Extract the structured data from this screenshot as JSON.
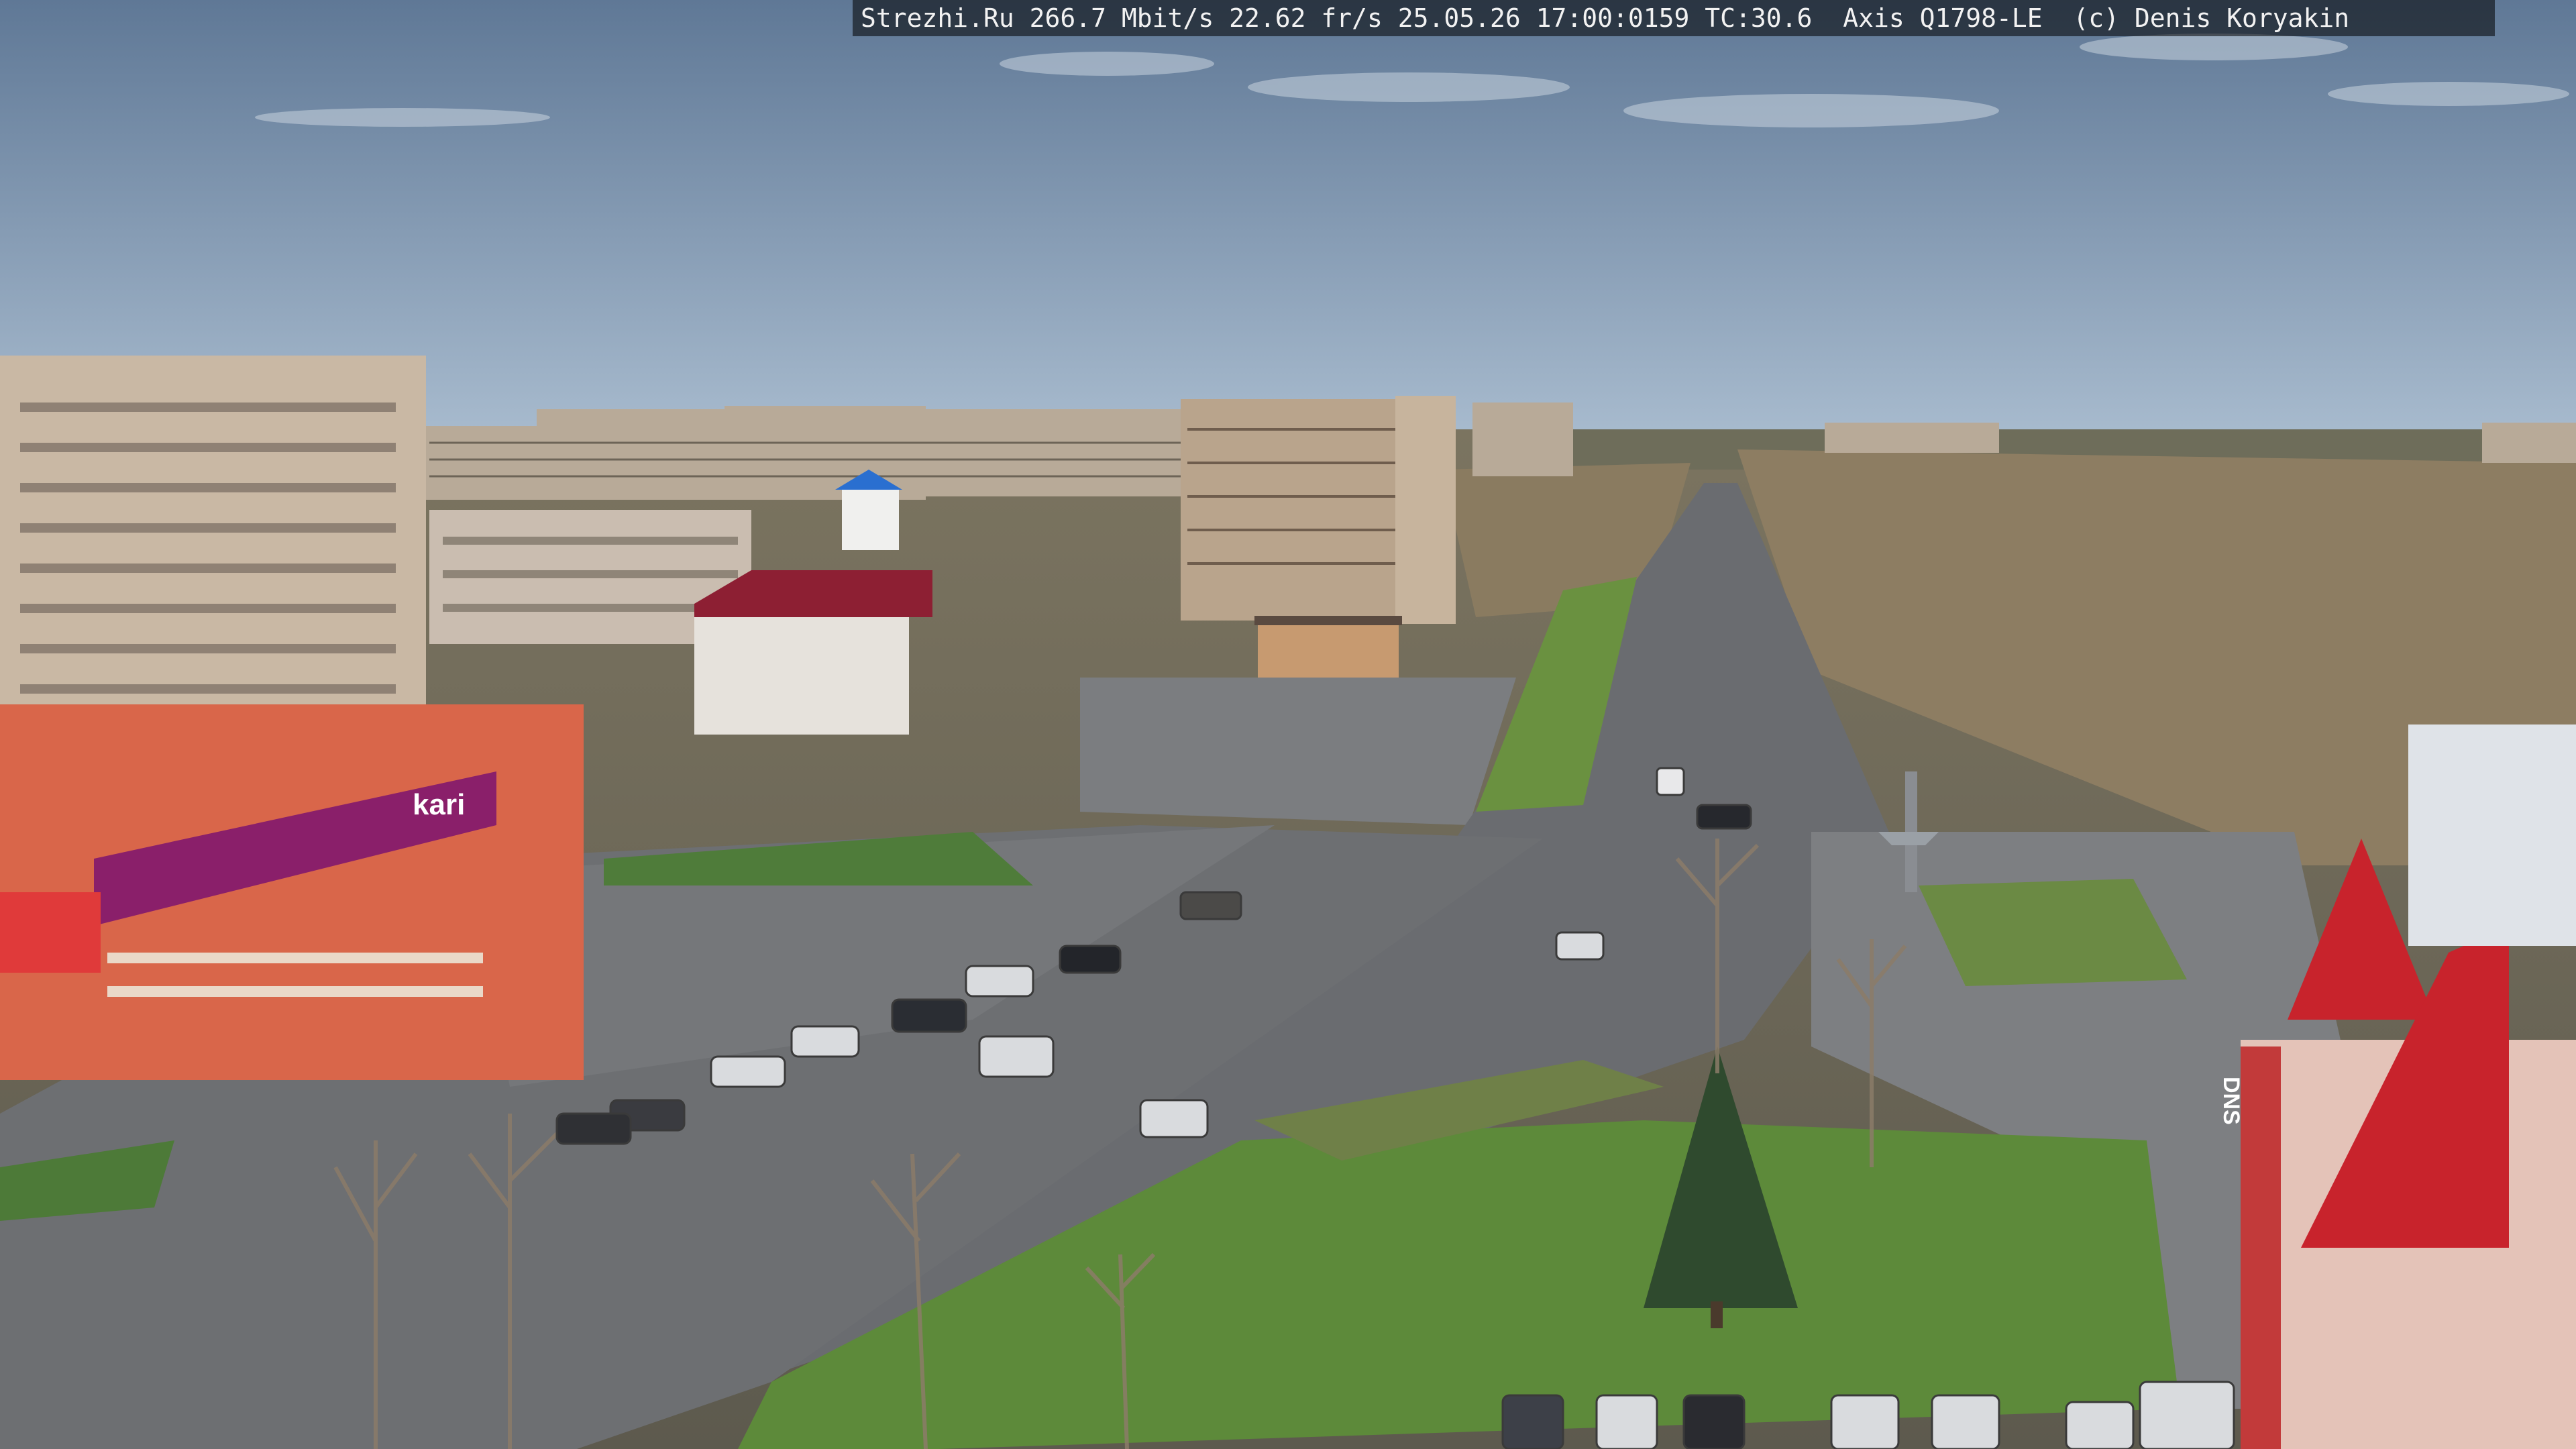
{
  "overlay": {
    "text": "Strezhi.Ru 266.7 Mbit/s 22.62 fr/s 25.05.26 17:00:0159 TC:30.6  Axis Q1798-LE  (c) Denis Koryakin"
  },
  "signs": {
    "store_left": "kari",
    "store_right": "DNS"
  },
  "colors": {
    "sky_top": "#5f7896",
    "sky_bottom": "#a9bccf",
    "asphalt": "#6a6c70",
    "grass": "#5d8a3a",
    "store_facade": "#d9664a",
    "kari_band": "#8a1f6a",
    "roof_red": "#c8232c",
    "panel_building": "#c9b8a4"
  }
}
